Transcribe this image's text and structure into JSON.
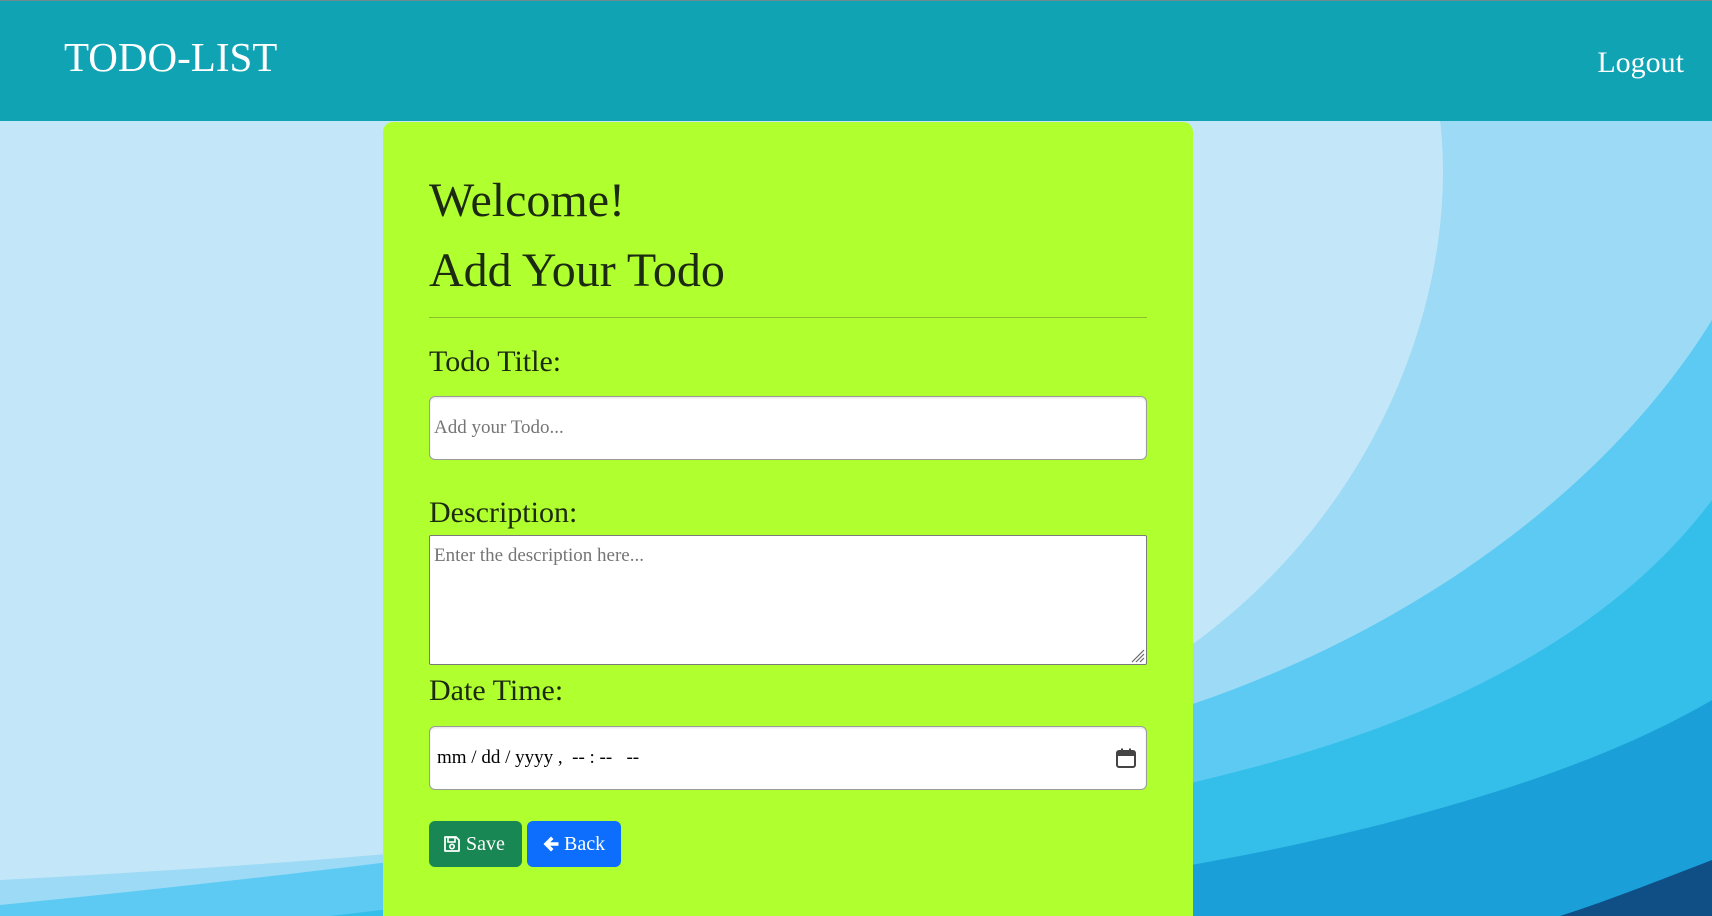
{
  "navbar": {
    "brand": "TODO-LIST",
    "logout_label": "Logout"
  },
  "form": {
    "heading_welcome": "Welcome!",
    "heading_add": "Add Your Todo",
    "title_label": "Todo Title:",
    "title_placeholder": "Add your Todo...",
    "description_label": "Description:",
    "description_placeholder": "Enter the description here...",
    "datetime_label": "Date Time:",
    "datetime_value": "mm / dd / yyyy ,  -- : --   --"
  },
  "buttons": {
    "save_label": "Save",
    "back_label": "Back",
    "save_icon": "save-icon",
    "back_icon": "arrow-left-icon"
  },
  "colors": {
    "navbar": "#0fa3b4",
    "card": "#b0ff2f",
    "save_button": "#198754",
    "back_button": "#0d6efd"
  }
}
